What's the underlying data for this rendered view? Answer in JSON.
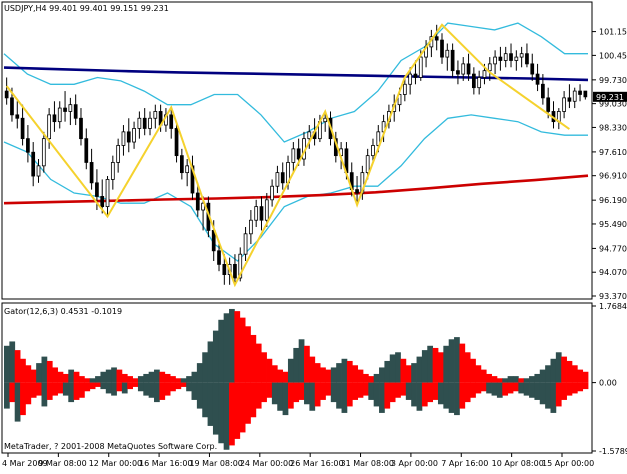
{
  "header": {
    "symbol_line": "USDJPY,H4  99.401 99.401 99.151 99.231"
  },
  "indicator": {
    "label": "Gator(12,6,3) 0.4531 -0.1019"
  },
  "footer": {
    "copyright": "MetaTrader, ? 2001-2008 MetaQuotes Software Corp."
  },
  "colors": {
    "background": "#ffffff",
    "bull_candle": "#ffffff",
    "bear_candle": "#000000",
    "ma_long": "#00007f",
    "ma_mid": "#cc0000",
    "bands": "#33bbdd",
    "zigzag": "#f5d22e",
    "gator_up": "#ff0000",
    "gator_down": "#2f4f4f",
    "price_marker": "#000000"
  },
  "chart_data": [
    {
      "type": "candlestick",
      "series": [
        {
          "name": "USDJPY,H4"
        }
      ],
      "x_ticks": [
        "4 Mar 2009",
        "9 Mar 08:00",
        "12 Mar 00:00",
        "16 Mar 16:00",
        "19 Mar 08:00",
        "24 Mar 00:00",
        "26 Mar 16:00",
        "31 Mar 08:00",
        "3 Apr 00:00",
        "7 Apr 16:00",
        "10 Apr 08:00",
        "15 Apr 00:00"
      ],
      "y_ticks": [
        "101.150",
        "100.450",
        "99.730",
        "99.030",
        "98.330",
        "97.610",
        "96.910",
        "96.190",
        "95.490",
        "94.770",
        "94.070",
        "93.370"
      ],
      "ylim": [
        93.37,
        101.55
      ],
      "current_price": "99.231",
      "grid": false,
      "ma_long": [
        100.09,
        100.04,
        99.99,
        99.95,
        99.92,
        99.89,
        99.86,
        99.83,
        99.8,
        99.77,
        99.73
      ],
      "ma_mid": [
        96.1,
        96.14,
        96.17,
        96.21,
        96.24,
        96.28,
        96.34,
        96.42,
        96.54,
        96.67,
        96.78,
        96.91
      ],
      "zigzag": [
        {
          "i": 0,
          "v": 99.55
        },
        {
          "i": 19,
          "v": 95.71
        },
        {
          "i": 31,
          "v": 98.92
        },
        {
          "i": 37,
          "v": 96.2
        },
        {
          "i": 43,
          "v": 93.7
        },
        {
          "i": 60,
          "v": 98.8
        },
        {
          "i": 66,
          "v": 96.05
        },
        {
          "i": 75,
          "v": 99.8
        },
        {
          "i": 82,
          "v": 101.35
        },
        {
          "i": 91,
          "v": 99.95
        },
        {
          "i": 106,
          "v": 98.28
        }
      ],
      "bands_upper": [
        100.5,
        99.9,
        99.6,
        99.6,
        99.8,
        99.7,
        99.4,
        99.0,
        99.0,
        99.3,
        99.3,
        98.7,
        97.9,
        98.2,
        98.6,
        98.8,
        99.4,
        100.3,
        100.7,
        101.4,
        101.3,
        101.2,
        101.4,
        101.0,
        100.5,
        100.5
      ],
      "bands_lower": [
        97.9,
        97.6,
        96.8,
        96.4,
        96.3,
        96.1,
        96.1,
        96.4,
        96.0,
        94.9,
        94.4,
        95.1,
        96.0,
        96.3,
        96.4,
        96.6,
        96.6,
        97.2,
        98.0,
        98.6,
        98.7,
        98.6,
        98.5,
        98.2,
        98.1,
        98.1
      ],
      "candles": [
        {
          "o": 99.4,
          "h": 99.8,
          "l": 99.0,
          "c": 99.2
        },
        {
          "o": 99.2,
          "h": 99.5,
          "l": 98.5,
          "c": 98.7
        },
        {
          "o": 98.7,
          "h": 99.1,
          "l": 98.3,
          "c": 98.6
        },
        {
          "o": 98.6,
          "h": 99.0,
          "l": 97.8,
          "c": 98.0
        },
        {
          "o": 98.0,
          "h": 98.4,
          "l": 97.3,
          "c": 97.6
        },
        {
          "o": 97.6,
          "h": 97.9,
          "l": 96.6,
          "c": 96.9
        },
        {
          "o": 96.9,
          "h": 97.4,
          "l": 96.7,
          "c": 97.2
        },
        {
          "o": 97.2,
          "h": 98.2,
          "l": 97.0,
          "c": 98.0
        },
        {
          "o": 98.0,
          "h": 98.9,
          "l": 97.7,
          "c": 98.7
        },
        {
          "o": 98.7,
          "h": 99.1,
          "l": 98.2,
          "c": 98.5
        },
        {
          "o": 98.5,
          "h": 99.1,
          "l": 98.3,
          "c": 98.9
        },
        {
          "o": 98.9,
          "h": 99.4,
          "l": 98.5,
          "c": 98.8
        },
        {
          "o": 98.8,
          "h": 99.2,
          "l": 98.4,
          "c": 99.0
        },
        {
          "o": 99.0,
          "h": 99.3,
          "l": 98.4,
          "c": 98.6
        },
        {
          "o": 98.6,
          "h": 98.9,
          "l": 97.8,
          "c": 98.0
        },
        {
          "o": 98.0,
          "h": 98.3,
          "l": 97.1,
          "c": 97.3
        },
        {
          "o": 97.3,
          "h": 97.7,
          "l": 96.5,
          "c": 96.7
        },
        {
          "o": 96.7,
          "h": 97.1,
          "l": 95.9,
          "c": 96.3
        },
        {
          "o": 96.3,
          "h": 96.8,
          "l": 95.8,
          "c": 96.0
        },
        {
          "o": 96.0,
          "h": 96.9,
          "l": 95.7,
          "c": 96.8
        },
        {
          "o": 96.8,
          "h": 97.5,
          "l": 96.5,
          "c": 97.3
        },
        {
          "o": 97.3,
          "h": 98.0,
          "l": 97.0,
          "c": 97.8
        },
        {
          "o": 97.8,
          "h": 98.4,
          "l": 97.5,
          "c": 98.2
        },
        {
          "o": 98.2,
          "h": 98.6,
          "l": 97.6,
          "c": 97.9
        },
        {
          "o": 97.9,
          "h": 98.5,
          "l": 97.7,
          "c": 98.3
        },
        {
          "o": 98.3,
          "h": 98.8,
          "l": 98.0,
          "c": 98.6
        },
        {
          "o": 98.6,
          "h": 98.9,
          "l": 98.1,
          "c": 98.3
        },
        {
          "o": 98.3,
          "h": 98.8,
          "l": 98.1,
          "c": 98.6
        },
        {
          "o": 98.6,
          "h": 99.0,
          "l": 98.3,
          "c": 98.8
        },
        {
          "o": 98.8,
          "h": 99.0,
          "l": 98.2,
          "c": 98.4
        },
        {
          "o": 98.4,
          "h": 98.9,
          "l": 98.2,
          "c": 98.7
        },
        {
          "o": 98.7,
          "h": 98.9,
          "l": 98.0,
          "c": 98.3
        },
        {
          "o": 98.3,
          "h": 98.5,
          "l": 97.3,
          "c": 97.5
        },
        {
          "o": 97.5,
          "h": 97.7,
          "l": 96.8,
          "c": 97.0
        },
        {
          "o": 97.0,
          "h": 97.4,
          "l": 96.6,
          "c": 97.2
        },
        {
          "o": 97.2,
          "h": 97.5,
          "l": 96.2,
          "c": 96.4
        },
        {
          "o": 96.4,
          "h": 96.7,
          "l": 95.7,
          "c": 95.9
        },
        {
          "o": 95.9,
          "h": 96.3,
          "l": 95.3,
          "c": 96.1
        },
        {
          "o": 96.1,
          "h": 96.3,
          "l": 95.1,
          "c": 95.3
        },
        {
          "o": 95.3,
          "h": 95.6,
          "l": 94.4,
          "c": 94.7
        },
        {
          "o": 94.7,
          "h": 95.0,
          "l": 94.1,
          "c": 94.3
        },
        {
          "o": 94.3,
          "h": 94.6,
          "l": 93.7,
          "c": 94.0
        },
        {
          "o": 94.0,
          "h": 94.5,
          "l": 93.7,
          "c": 94.3
        },
        {
          "o": 94.3,
          "h": 94.6,
          "l": 93.7,
          "c": 93.9
        },
        {
          "o": 93.9,
          "h": 94.8,
          "l": 93.8,
          "c": 94.6
        },
        {
          "o": 94.6,
          "h": 95.4,
          "l": 94.4,
          "c": 95.2
        },
        {
          "o": 95.2,
          "h": 95.9,
          "l": 94.9,
          "c": 95.6
        },
        {
          "o": 95.6,
          "h": 96.2,
          "l": 95.4,
          "c": 96.0
        },
        {
          "o": 96.0,
          "h": 96.3,
          "l": 95.3,
          "c": 95.6
        },
        {
          "o": 95.6,
          "h": 96.4,
          "l": 95.4,
          "c": 96.2
        },
        {
          "o": 96.2,
          "h": 96.8,
          "l": 96.0,
          "c": 96.6
        },
        {
          "o": 96.6,
          "h": 97.2,
          "l": 96.4,
          "c": 97.0
        },
        {
          "o": 97.0,
          "h": 97.3,
          "l": 96.5,
          "c": 96.7
        },
        {
          "o": 96.7,
          "h": 97.5,
          "l": 96.5,
          "c": 97.3
        },
        {
          "o": 97.3,
          "h": 97.9,
          "l": 97.0,
          "c": 97.7
        },
        {
          "o": 97.7,
          "h": 98.0,
          "l": 97.2,
          "c": 97.4
        },
        {
          "o": 97.4,
          "h": 98.2,
          "l": 97.2,
          "c": 98.0
        },
        {
          "o": 98.0,
          "h": 98.4,
          "l": 97.7,
          "c": 98.2
        },
        {
          "o": 98.2,
          "h": 98.6,
          "l": 97.8,
          "c": 98.0
        },
        {
          "o": 98.0,
          "h": 98.7,
          "l": 97.9,
          "c": 98.5
        },
        {
          "o": 98.5,
          "h": 98.8,
          "l": 98.2,
          "c": 98.6
        },
        {
          "o": 98.6,
          "h": 98.8,
          "l": 97.8,
          "c": 98.0
        },
        {
          "o": 98.0,
          "h": 98.2,
          "l": 97.3,
          "c": 97.5
        },
        {
          "o": 97.5,
          "h": 97.9,
          "l": 97.1,
          "c": 97.7
        },
        {
          "o": 97.7,
          "h": 97.9,
          "l": 96.8,
          "c": 97.0
        },
        {
          "o": 97.0,
          "h": 97.3,
          "l": 96.3,
          "c": 96.5
        },
        {
          "o": 96.5,
          "h": 96.9,
          "l": 96.1,
          "c": 96.4
        },
        {
          "o": 96.4,
          "h": 97.2,
          "l": 96.2,
          "c": 97.0
        },
        {
          "o": 97.0,
          "h": 97.7,
          "l": 96.8,
          "c": 97.5
        },
        {
          "o": 97.5,
          "h": 98.0,
          "l": 97.3,
          "c": 97.8
        },
        {
          "o": 97.8,
          "h": 98.4,
          "l": 97.6,
          "c": 98.2
        },
        {
          "o": 98.2,
          "h": 98.7,
          "l": 97.9,
          "c": 98.5
        },
        {
          "o": 98.5,
          "h": 99.0,
          "l": 98.3,
          "c": 98.8
        },
        {
          "o": 98.8,
          "h": 99.3,
          "l": 98.5,
          "c": 99.0
        },
        {
          "o": 99.0,
          "h": 99.5,
          "l": 98.8,
          "c": 99.3
        },
        {
          "o": 99.3,
          "h": 99.8,
          "l": 99.1,
          "c": 99.6
        },
        {
          "o": 99.6,
          "h": 100.1,
          "l": 99.3,
          "c": 99.9
        },
        {
          "o": 99.9,
          "h": 100.3,
          "l": 99.6,
          "c": 99.8
        },
        {
          "o": 99.8,
          "h": 100.6,
          "l": 99.7,
          "c": 100.4
        },
        {
          "o": 100.4,
          "h": 100.9,
          "l": 100.1,
          "c": 100.7
        },
        {
          "o": 100.7,
          "h": 101.2,
          "l": 100.4,
          "c": 101.0
        },
        {
          "o": 101.0,
          "h": 101.35,
          "l": 100.6,
          "c": 100.9
        },
        {
          "o": 100.9,
          "h": 101.1,
          "l": 100.2,
          "c": 100.4
        },
        {
          "o": 100.4,
          "h": 100.8,
          "l": 100.0,
          "c": 100.6
        },
        {
          "o": 100.6,
          "h": 100.8,
          "l": 99.8,
          "c": 100.0
        },
        {
          "o": 100.0,
          "h": 100.3,
          "l": 99.6,
          "c": 99.9
        },
        {
          "o": 99.9,
          "h": 100.4,
          "l": 99.7,
          "c": 100.2
        },
        {
          "o": 100.2,
          "h": 100.5,
          "l": 99.7,
          "c": 99.9
        },
        {
          "o": 99.9,
          "h": 100.1,
          "l": 99.3,
          "c": 99.5
        },
        {
          "o": 99.5,
          "h": 100.0,
          "l": 99.3,
          "c": 99.8
        },
        {
          "o": 99.8,
          "h": 100.2,
          "l": 99.6,
          "c": 100.0
        },
        {
          "o": 100.0,
          "h": 100.4,
          "l": 99.7,
          "c": 100.2
        },
        {
          "o": 100.2,
          "h": 100.6,
          "l": 99.9,
          "c": 100.4
        },
        {
          "o": 100.4,
          "h": 100.7,
          "l": 100.0,
          "c": 100.3
        },
        {
          "o": 100.3,
          "h": 100.7,
          "l": 100.1,
          "c": 100.5
        },
        {
          "o": 100.5,
          "h": 100.8,
          "l": 100.1,
          "c": 100.3
        },
        {
          "o": 100.3,
          "h": 100.6,
          "l": 100.0,
          "c": 100.4
        },
        {
          "o": 100.4,
          "h": 100.7,
          "l": 100.1,
          "c": 100.5
        },
        {
          "o": 100.5,
          "h": 100.8,
          "l": 100.1,
          "c": 100.2
        },
        {
          "o": 100.2,
          "h": 100.5,
          "l": 99.7,
          "c": 99.9
        },
        {
          "o": 99.9,
          "h": 100.2,
          "l": 99.4,
          "c": 99.6
        },
        {
          "o": 99.6,
          "h": 99.9,
          "l": 99.0,
          "c": 99.2
        },
        {
          "o": 99.2,
          "h": 99.5,
          "l": 98.6,
          "c": 98.8
        },
        {
          "o": 98.8,
          "h": 99.1,
          "l": 98.3,
          "c": 98.5
        },
        {
          "o": 98.5,
          "h": 98.9,
          "l": 98.28,
          "c": 98.8
        },
        {
          "o": 98.8,
          "h": 99.4,
          "l": 98.6,
          "c": 99.2
        },
        {
          "o": 99.2,
          "h": 99.6,
          "l": 98.9,
          "c": 99.1
        },
        {
          "o": 99.1,
          "h": 99.5,
          "l": 98.9,
          "c": 99.4
        },
        {
          "o": 99.4,
          "h": 99.6,
          "l": 99.1,
          "c": 99.3
        },
        {
          "o": 99.4,
          "h": 99.4,
          "l": 99.15,
          "c": 99.23
        }
      ]
    },
    {
      "type": "bar",
      "series": [
        {
          "name": "Gator(12,6,3)"
        }
      ],
      "y_ticks": [
        "1.7684",
        "0.00",
        "-1.5789"
      ],
      "ylim": [
        -1.5789,
        1.7684
      ],
      "upper": [
        0.85,
        0.95,
        0.75,
        0.55,
        0.4,
        0.3,
        0.45,
        0.6,
        0.5,
        0.35,
        0.25,
        0.2,
        0.3,
        0.25,
        0.15,
        0.1,
        0.1,
        0.15,
        0.25,
        0.3,
        0.35,
        0.3,
        0.2,
        0.15,
        0.1,
        0.15,
        0.2,
        0.25,
        0.3,
        0.25,
        0.2,
        0.15,
        0.1,
        0.1,
        0.15,
        0.25,
        0.45,
        0.7,
        0.95,
        1.2,
        1.45,
        1.6,
        1.7,
        1.65,
        1.5,
        1.3,
        1.1,
        0.9,
        0.7,
        0.55,
        0.4,
        0.3,
        0.25,
        0.55,
        0.8,
        1.0,
        0.85,
        0.6,
        0.45,
        0.35,
        0.3,
        0.35,
        0.45,
        0.55,
        0.5,
        0.4,
        0.3,
        0.2,
        0.15,
        0.2,
        0.35,
        0.5,
        0.65,
        0.7,
        0.55,
        0.4,
        0.45,
        0.6,
        0.75,
        0.85,
        0.8,
        0.7,
        0.85,
        1.0,
        1.05,
        0.9,
        0.7,
        0.55,
        0.4,
        0.3,
        0.2,
        0.15,
        0.1,
        0.1,
        0.15,
        0.15,
        0.1,
        0.1,
        0.15,
        0.2,
        0.3,
        0.4,
        0.55,
        0.7,
        0.6,
        0.5,
        0.4,
        0.3,
        0.25
      ],
      "lower": [
        -0.6,
        -0.45,
        -0.9,
        -0.75,
        -0.5,
        -0.35,
        -0.3,
        -0.55,
        -0.4,
        -0.3,
        -0.25,
        -0.3,
        -0.45,
        -0.4,
        -0.35,
        -0.2,
        -0.15,
        -0.1,
        -0.15,
        -0.25,
        -0.3,
        -0.2,
        -0.25,
        -0.15,
        -0.1,
        -0.2,
        -0.3,
        -0.35,
        -0.45,
        -0.4,
        -0.3,
        -0.2,
        -0.15,
        -0.1,
        -0.2,
        -0.4,
        -0.6,
        -0.8,
        -1.0,
        -1.2,
        -1.4,
        -1.55,
        -1.45,
        -1.3,
        -1.15,
        -0.95,
        -0.8,
        -0.6,
        -0.45,
        -0.35,
        -0.5,
        -0.65,
        -0.75,
        -0.6,
        -0.45,
        -0.4,
        -0.5,
        -0.65,
        -0.55,
        -0.4,
        -0.3,
        -0.45,
        -0.6,
        -0.7,
        -0.55,
        -0.4,
        -0.35,
        -0.3,
        -0.4,
        -0.55,
        -0.7,
        -0.6,
        -0.45,
        -0.35,
        -0.3,
        -0.4,
        -0.55,
        -0.65,
        -0.55,
        -0.45,
        -0.4,
        -0.5,
        -0.6,
        -0.7,
        -0.75,
        -0.6,
        -0.45,
        -0.35,
        -0.25,
        -0.2,
        -0.25,
        -0.3,
        -0.35,
        -0.3,
        -0.25,
        -0.2,
        -0.25,
        -0.3,
        -0.35,
        -0.4,
        -0.5,
        -0.6,
        -0.7,
        -0.55,
        -0.4,
        -0.3,
        -0.25,
        -0.2,
        -0.15
      ],
      "y_ticks_marker": "0.00"
    }
  ]
}
